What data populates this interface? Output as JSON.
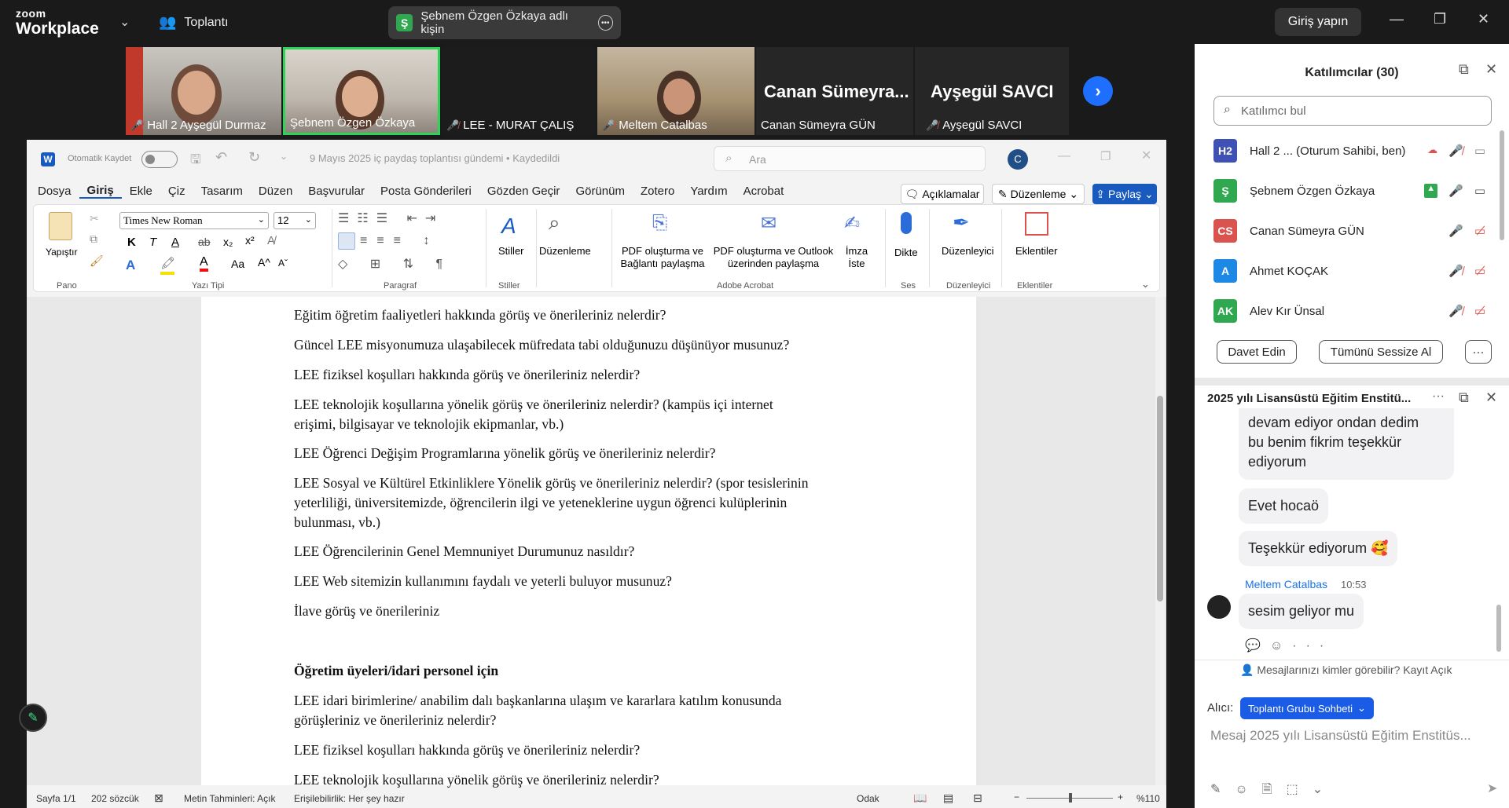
{
  "zoom": {
    "logo_line1": "zoom",
    "logo_line2": "Workplace",
    "meeting_label": "Toplantı",
    "screenshare_pill": "Şebnem Özgen Özkaya adlı kişin",
    "screenshare_badge": "Ş",
    "signin": "Giriş yapın"
  },
  "videos": [
    {
      "name": "Hall 2 Ayşegül Durmaz",
      "muted": true
    },
    {
      "name": "Şebnem Özgen Özkaya",
      "muted": false
    },
    {
      "name": "LEE - MURAT ÇALIŞ",
      "muted": true
    },
    {
      "name": "Meltem Catalbas",
      "muted": true
    },
    {
      "name": "Canan Sümeyra GÜN",
      "big": "Canan  Sümeyra...",
      "muted": false
    },
    {
      "name": "Ayşegül SAVCI",
      "big": "Ayşegül SAVCI",
      "muted": true
    }
  ],
  "word": {
    "autosave": "Otomatik Kaydet",
    "doc_title": "9 Mayıs 2025 iç paydaş toplantısı gündemi • Kaydedildi",
    "search_placeholder": "Ara",
    "user_initial": "C",
    "menu": [
      "Dosya",
      "Giriş",
      "Ekle",
      "Çiz",
      "Tasarım",
      "Düzen",
      "Başvurular",
      "Posta Gönderileri",
      "Gözden Geçir",
      "Görünüm",
      "Zotero",
      "Yardım",
      "Acrobat"
    ],
    "comments_btn": "Açıklamalar",
    "editing_btn": "Düzenleme",
    "share_btn": "Paylaş",
    "ribbon": {
      "paste": "Yapıştır",
      "font_name": "Times New Roman",
      "font_size": "12",
      "styles": "Stiller",
      "editing": "Düzenleme",
      "pdf_share": "PDF oluşturma ve Bağlantı paylaşma",
      "pdf_outlook": "PDF oluşturma ve Outlook üzerinden paylaşma",
      "sign": "İmza İste",
      "dictate": "Dikte",
      "editor": "Düzenleyici",
      "addins": "Eklentiler",
      "groups": [
        "Pano",
        "Yazı Tipi",
        "Paragraf",
        "Stiller",
        "Adobe Acrobat",
        "Ses",
        "Düzenleyici",
        "Eklentiler"
      ]
    },
    "lines": [
      "Eğitim öğretim faaliyetleri hakkında görüş ve önerileriniz nelerdir?",
      "Güncel LEE misyonumuza ulaşabilecek müfredata tabi olduğunuzu düşünüyor musunuz?",
      "LEE fiziksel koşulları hakkında görüş ve önerileriniz nelerdir?",
      "LEE teknolojik koşullarına yönelik görüş ve önerileriniz nelerdir? (kampüs içi internet",
      "erişimi, bilgisayar ve teknolojik ekipmanlar, vb.)",
      "LEE Öğrenci Değişim Programlarına yönelik görüş ve önerileriniz nelerdir?",
      "LEE Sosyal ve Kültürel Etkinliklere Yönelik görüş ve önerileriniz nelerdir? (spor tesislerinin",
      "yeterliliği, üniversitemizde, öğrencilerin ilgi ve yeteneklerine uygun öğrenci kulüplerinin",
      "bulunması, vb.)",
      "LEE Öğrencilerinin Genel Memnuniyet Durumunuz nasıldır?",
      "LEE Web sitemizin kullanımını faydalı ve yeterli buluyor musunuz?",
      "İlave görüş ve önerileriniz",
      "Öğretim üyeleri/idari personel için",
      "LEE idari birimlerine/ anabilim dalı başkanlarına ulaşım ve kararlara katılım konusunda",
      "görüşleriniz ve önerileriniz nelerdir?",
      "LEE fiziksel koşulları hakkında görüş ve önerileriniz nelerdir?",
      "LEE teknolojik koşullarına yönelik görüş ve önerileriniz nelerdir?"
    ],
    "status": {
      "page": "Sayfa 1/1",
      "words": "202 sözcük",
      "text_pred": "Metin Tahminleri: Açık",
      "accessibility": "Erişilebilirlik: Her şey hazır",
      "focus": "Odak",
      "zoom": "%110"
    }
  },
  "participants": {
    "title": "Katılımcılar (30)",
    "search_placeholder": "Katılımcı bul",
    "list": [
      {
        "initials": "H2",
        "name": "Hall 2 ...  (Oturum Sahibi, ben)",
        "color": "#3f51b5"
      },
      {
        "initials": "Ş",
        "name": "Şebnem Özgen Özkaya",
        "color": "#2fa84f"
      },
      {
        "initials": "CS",
        "name": "Canan Sümeyra GÜN",
        "color": "#d9534f"
      },
      {
        "initials": "A",
        "name": "Ahmet KOÇAK",
        "color": "#1e88e5"
      },
      {
        "initials": "AK",
        "name": "Alev Kır Ünsal",
        "color": "#2fa84f"
      }
    ],
    "invite": "Davet Edin",
    "mute_all": "Tümünü Sessize Al"
  },
  "chat": {
    "title": "2025 yılı Lisansüstü Eğitim Enstitü...",
    "msg1": [
      "devam ediyor  ondan dedim",
      "bu benim fikrim teşekkür",
      "ediyorum"
    ],
    "msg2": "Evet hocaö",
    "msg3": "Teşekkür ediyorum 🥰",
    "sender": "Meltem Catalbas",
    "time": "10:53",
    "msg4": "sesim geliyor mu",
    "visibility": "Mesajlarınızı kimler görebilir? Kayıt Açık",
    "to_label": "Alıcı:",
    "to_value": "Toplantı Grubu Sohbeti",
    "input_placeholder": "Mesaj 2025 yılı Lisansüstü Eğitim Enstitüs..."
  }
}
